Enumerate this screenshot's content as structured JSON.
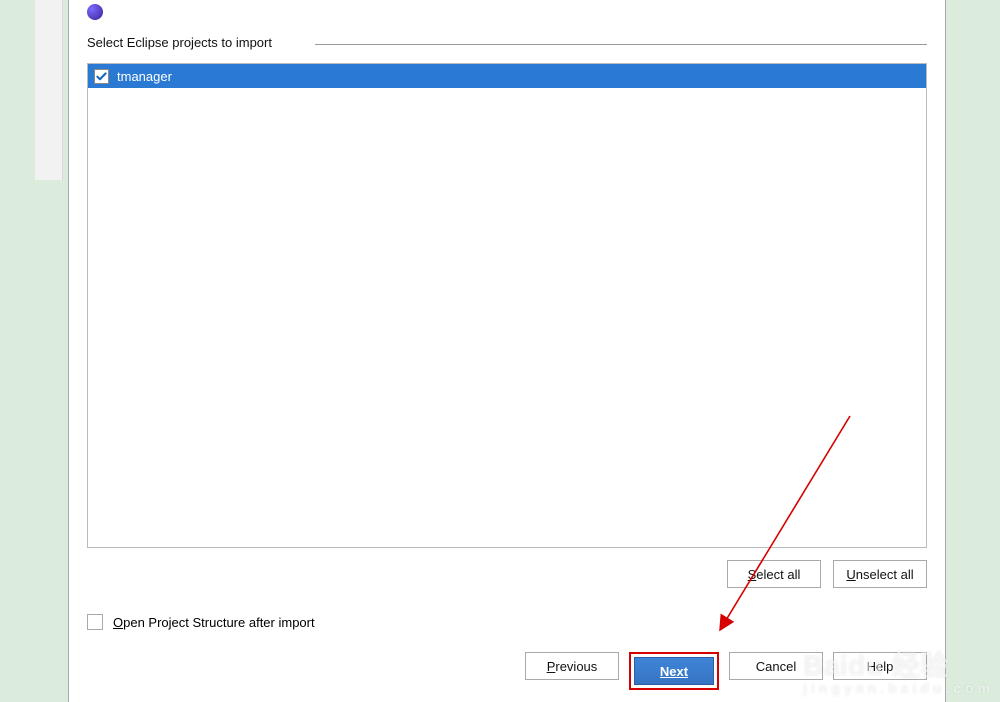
{
  "group": {
    "legend": "Select Eclipse projects to import",
    "items": [
      {
        "label": "tmanager",
        "checked": true
      }
    ]
  },
  "buttons": {
    "select_all": "Select all",
    "unselect_all": "Unselect all",
    "previous": "Previous",
    "next": "Next",
    "cancel": "Cancel",
    "help": "Help"
  },
  "options": {
    "open_project_structure": "Open Project Structure after import"
  },
  "watermark": {
    "brand": "Baidu 经验",
    "url": "jingyan.baidu.com"
  }
}
